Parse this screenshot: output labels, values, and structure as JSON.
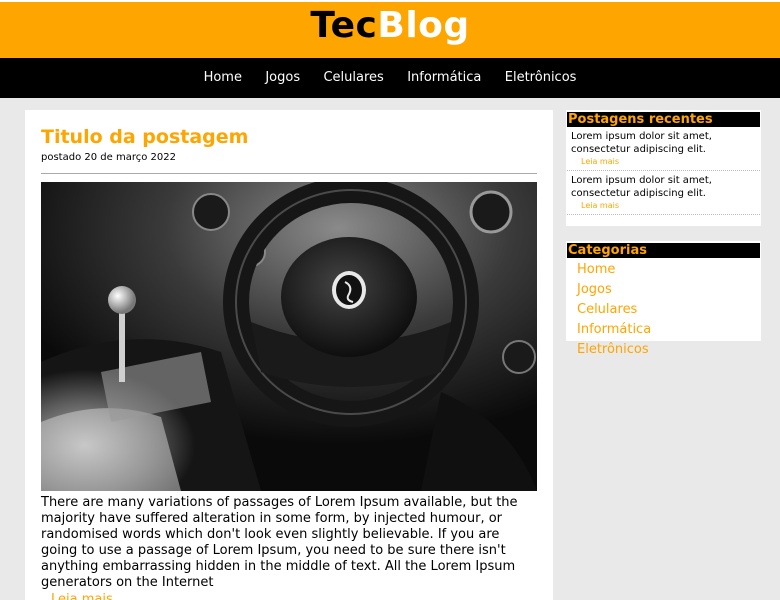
{
  "header": {
    "logo_part1": "Tec",
    "logo_part2": "Blog",
    "accent": "#ffa500"
  },
  "nav": {
    "items": [
      "Home",
      "Jogos",
      "Celulares",
      "Informática",
      "Eletrônicos"
    ]
  },
  "post": {
    "title": "Titulo da postagem",
    "date": "postado 20 de março 2022",
    "image_alt": "car-interior-photo",
    "text": "There are many variations of passages of Lorem Ipsum available, but the majority have suffered alteration in some form, by injected humour, or randomised words which don't look even slightly believable. If you are going to use a passage of Lorem Ipsum, you need to be sure there isn't anything embarrassing hidden in the middle of text. All the Lorem Ipsum generators on the Internet",
    "read_more": "Leia mais"
  },
  "recent": {
    "title": "Postagens recentes",
    "items": [
      {
        "text": "Lorem ipsum dolor sit amet, consectetur adipiscing elit.",
        "read_more": "Leia mais"
      },
      {
        "text": "Lorem ipsum dolor sit amet, consectetur adipiscing elit.",
        "read_more": "Leia mais"
      }
    ]
  },
  "categories": {
    "title": "Categorias",
    "items": [
      "Home",
      "Jogos",
      "Celulares",
      "Informática",
      "Eletrônicos"
    ]
  }
}
